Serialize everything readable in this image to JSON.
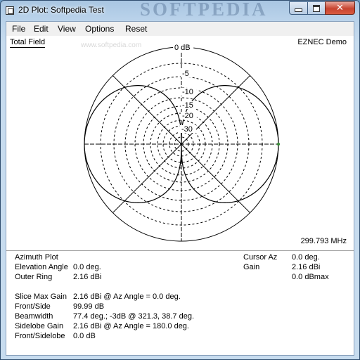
{
  "window": {
    "title": "2D Plot: Softpedia Test",
    "watermark": "SOFTPEDIA"
  },
  "menu": [
    "File",
    "Edit",
    "View",
    "Options",
    "Reset"
  ],
  "plot": {
    "top_left_label": "Total Field",
    "top_right_label": "EZNEC Demo",
    "bottom_right_label": "299.793 MHz",
    "faint_url": "www.softpedia.com",
    "ring_labels": [
      "0 dB",
      "-5",
      "-10",
      "-15",
      "-20",
      "-30"
    ]
  },
  "info_left": [
    {
      "label": "Azimuth Plot",
      "value": ""
    },
    {
      "label": "Elevation Angle",
      "value": "0.0 deg."
    },
    {
      "label": "Outer Ring",
      "value": "2.16 dBi"
    }
  ],
  "info_left2": [
    {
      "label": "Slice Max Gain",
      "value": "2.16 dBi @ Az Angle = 0.0 deg."
    },
    {
      "label": "Front/Side",
      "value": "99.99 dB"
    },
    {
      "label": "Beamwidth",
      "value": "77.4 deg.; -3dB @ 321.3, 38.7 deg."
    },
    {
      "label": "Sidelobe Gain",
      "value": "2.16 dBi @ Az Angle = 180.0 deg."
    },
    {
      "label": "Front/Sidelobe",
      "value": "0.0 dB"
    }
  ],
  "info_right": [
    {
      "label": "Cursor Az",
      "value": "0.0 deg."
    },
    {
      "label": "Gain",
      "value": "2.16 dBi"
    },
    {
      "label": "",
      "value": "0.0 dBmax"
    }
  ],
  "colors": {
    "accent_cursor_dot": "#3c8c3c"
  }
}
